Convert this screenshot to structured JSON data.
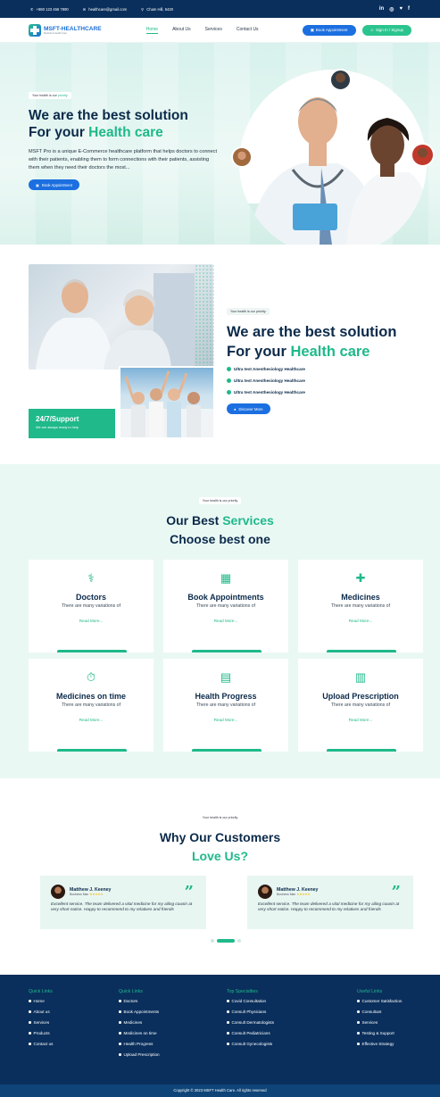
{
  "topbar": {
    "phone": "+880 123 456 7890",
    "email": "healthcare@gmail.com",
    "location": "Cham Hill, 5420",
    "social": [
      "in",
      "◎",
      "❤",
      "f"
    ]
  },
  "nav": {
    "logo_title": "MSFT-HEALTHCARE",
    "logo_sub": "Medical & Health Care",
    "menu": [
      "Home",
      "About Us",
      "Services",
      "Contact Us"
    ],
    "book_btn": "Book Appointment",
    "sign_btn": "Sign In / Signup"
  },
  "hero": {
    "tag_pre": "Your health is our ",
    "tag_hl": "priority",
    "line1": "We are the best solution",
    "line2_pre": "For your ",
    "line2_hl": "Health care",
    "desc": "MSFT Pro is a unique E-Commerce healthcare platform that helps doctors to connect with their patients, enabling them to form connections with their patients, assisting them when they need their doctors the most...",
    "btn": "Book Appointment"
  },
  "about": {
    "tag": "Your health is our priority",
    "line1": "We are the best solution",
    "line2_pre": "For your ",
    "line2_hl": "Health care",
    "checks": [
      "Ultra test Anesthesiology Healthcare",
      "Ultra test Anesthesiology Healthcare",
      "Ultra test Anesthesiology Healthcare"
    ],
    "btn": "Discover More",
    "support_title": "24/7/Support",
    "support_sub": "We are always ready to help"
  },
  "services": {
    "tag": "Your health is our priority",
    "title_pre": "Our Best ",
    "title_hl": "Services",
    "subtitle": "Choose best one",
    "cards": [
      {
        "title": "Doctors",
        "desc": "There are many variations of",
        "link": "Read More...",
        "icon": "stethoscope-icon"
      },
      {
        "title": "Book Appointments",
        "desc": "There are many variations of",
        "link": "Read More...",
        "icon": "calendar-check-icon"
      },
      {
        "title": "Medicines",
        "desc": "There are many variations of",
        "link": "Read More...",
        "icon": "pills-icon"
      },
      {
        "title": "Medicines on time",
        "desc": "There are many variations of",
        "link": "Read More...",
        "icon": "timer-icon"
      },
      {
        "title": "Health Progress",
        "desc": "There are many variations of",
        "link": "Read More...",
        "icon": "chart-line-icon"
      },
      {
        "title": "Upload Prescription",
        "desc": "There are many variations of",
        "link": "Read More...",
        "icon": "prescription-icon"
      }
    ]
  },
  "testimonials": {
    "tag": "Your health is our priority",
    "title": "Why Our Customers",
    "title_hl": "Love Us?",
    "items": [
      {
        "name": "Matthew J. Keeney",
        "role": "Business Man",
        "stars": "★★★★★",
        "review": "Excellent service. The team delivered a vital medicine for my ailing cousin at very short notice. Happy to recommend to my relatives and friends"
      },
      {
        "name": "Matthew J. Keeney",
        "role": "Business Man",
        "stars": "★★★★★",
        "review": "Excellent service. The team delivered a vital medicine for my ailing cousin at very short notice. Happy to recommend to my relatives and friends"
      }
    ]
  },
  "footer": {
    "cols": [
      {
        "head": "Quick Links",
        "items": [
          "Home",
          "About us",
          "Services",
          "Products",
          "Contact us"
        ]
      },
      {
        "head": "Quick Links",
        "items": [
          "Doctors",
          "Book Appointments",
          "Medicines",
          "Medicines on time",
          "Health Progress",
          "Upload Prescription"
        ]
      },
      {
        "head": "Top Specialties",
        "items": [
          "Covid Consultation",
          "Consult Physicians",
          "Consult Dermatologists",
          "Consult Pediatricians",
          "Consult Gynecologists"
        ]
      },
      {
        "head": "Useful Links",
        "items": [
          "Customer Satisfaction",
          "Consultant",
          "Services",
          "Testing & Support",
          "Effective Strategy"
        ]
      }
    ],
    "copyright": "Copyright © 2023 MSFT Health Care. All rights reserved"
  },
  "colors": {
    "navy": "#0a2f5c",
    "green": "#1fb98a",
    "blue": "#1b6fe0",
    "mint": "#eaf8f4"
  }
}
